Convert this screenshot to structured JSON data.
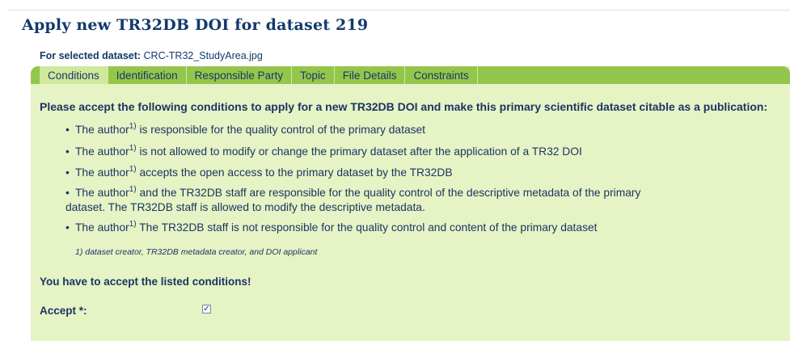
{
  "page": {
    "title": "Apply new TR32DB DOI for dataset 219",
    "selected_label": "For selected dataset:",
    "selected_value": "CRC-TR32_StudyArea.jpg"
  },
  "tabs": [
    {
      "label": "Conditions",
      "active": true
    },
    {
      "label": "Identification",
      "active": false
    },
    {
      "label": "Responsible Party",
      "active": false
    },
    {
      "label": "Topic",
      "active": false
    },
    {
      "label": "File Details",
      "active": false
    },
    {
      "label": "Constraints",
      "active": false
    }
  ],
  "conditions": {
    "intro": "Please accept the following conditions to apply for a new TR32DB DOI and make this primary scientific dataset citable as a publication:",
    "bullet": "•",
    "author_word": "The author",
    "footnote_mark": "1)",
    "items": [
      "is responsible for the quality control of the primary dataset",
      "is not allowed to modify or change the primary dataset after the application of a TR32 DOI",
      "accepts the open access to the primary dataset by the TR32DB",
      "and the TR32DB staff are responsible for the quality control of the descriptive metadata of the primary",
      "The TR32DB staff is not responsible for the quality control and content of the primary dataset"
    ],
    "item4_continuation": "dataset. The TR32DB staff is allowed to modify the descriptive metadata.",
    "footnote": "1) dataset creator, TR32DB metadata creator, and DOI applicant",
    "must_accept": "You have to accept the listed conditions!"
  },
  "accept": {
    "label": "Accept *:",
    "checked": true,
    "check_glyph": "✓"
  },
  "colors": {
    "title": "#123a6b",
    "tabbar": "#95c64c",
    "active_tab": "#cfe89b",
    "panel": "#e6f3c4"
  }
}
